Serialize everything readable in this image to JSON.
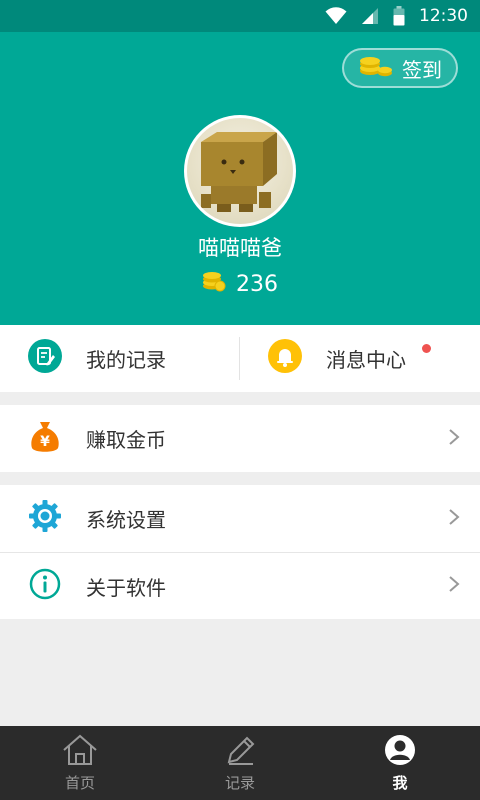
{
  "status_bar": {
    "time": "12:30"
  },
  "header": {
    "checkin_label": "签到",
    "username": "喵喵喵爸",
    "coin_count": "236"
  },
  "quick": {
    "records_label": "我的记录",
    "messages_label": "消息中心"
  },
  "menu": {
    "earn_label": "赚取金币",
    "settings_label": "系统设置",
    "about_label": "关于软件"
  },
  "tabbar": {
    "home_label": "首页",
    "records_label": "记录",
    "me_label": "我"
  },
  "colors": {
    "accent": "#00a896",
    "status_bar": "#00897b",
    "coin": "#f6d11e",
    "orange": "#f57c00",
    "bell": "#ffc107",
    "notify_dot": "#ef5350"
  }
}
